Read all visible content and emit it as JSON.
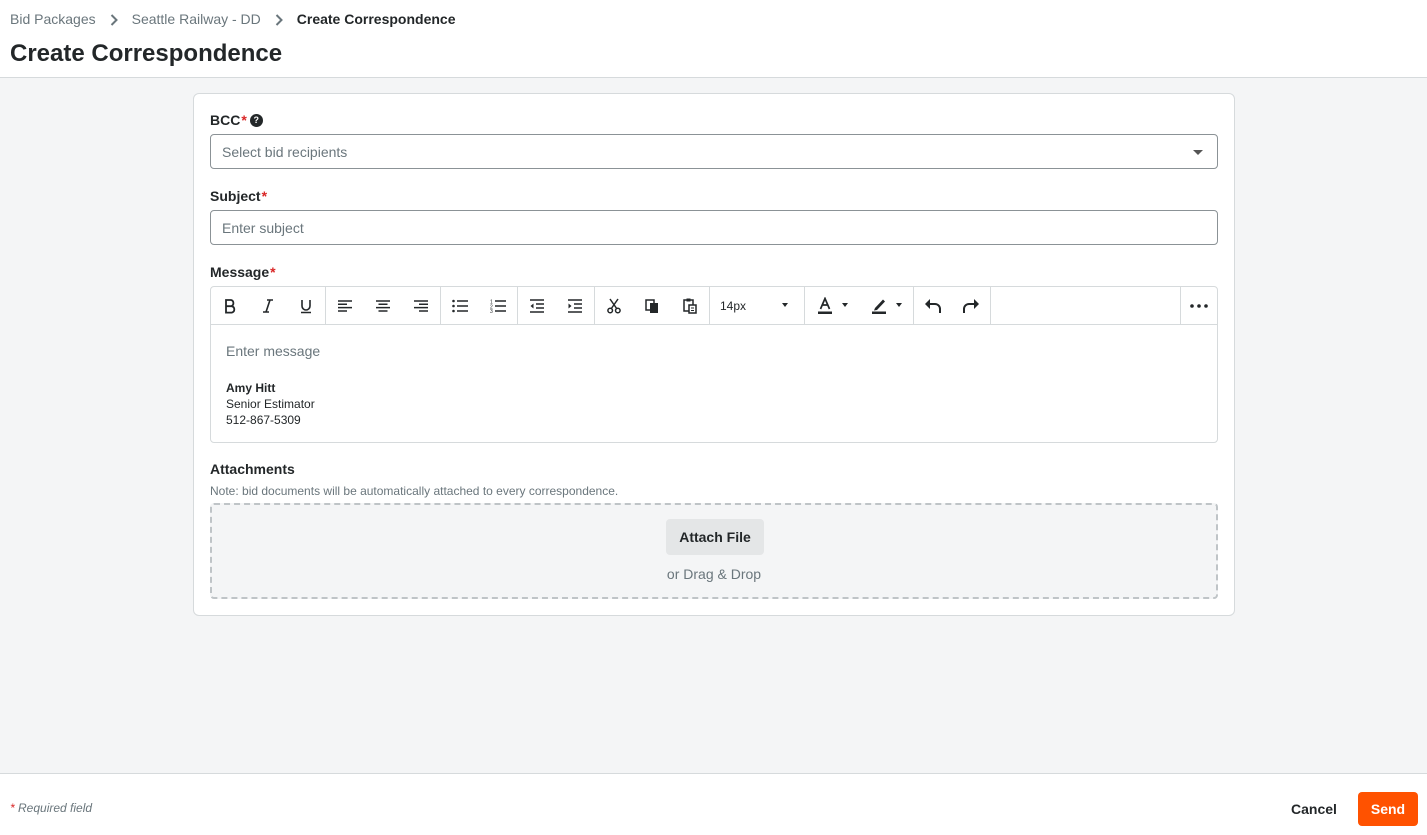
{
  "breadcrumb": {
    "items": [
      "Bid Packages",
      "Seattle Railway - DD",
      "Create Correspondence"
    ]
  },
  "page": {
    "title": "Create Correspondence"
  },
  "form": {
    "bcc": {
      "label": "BCC",
      "required_marker": "*",
      "help_icon": "question-circle-icon",
      "placeholder": "Select bid recipients"
    },
    "subject": {
      "label": "Subject",
      "required_marker": "*",
      "placeholder": "Enter subject",
      "value": ""
    },
    "message": {
      "label": "Message",
      "required_marker": "*",
      "placeholder": "Enter message",
      "font_size": "14px",
      "toolbar_icons": [
        "bold-icon",
        "italic-icon",
        "underline-icon",
        "align-left-icon",
        "align-center-icon",
        "align-right-icon",
        "bulleted-list-icon",
        "numbered-list-icon",
        "outdent-icon",
        "indent-icon",
        "cut-icon",
        "copy-icon",
        "paste-icon",
        "font-size-select",
        "font-color-icon",
        "highlight-color-icon",
        "undo-icon",
        "redo-icon",
        "more-icon"
      ],
      "signature": {
        "name": "Amy Hitt",
        "title": "Senior Estimator",
        "phone": "512-867-5309"
      }
    },
    "attachments": {
      "label": "Attachments",
      "note": "Note: bid documents will be automatically attached to every correspondence.",
      "attach_button": "Attach File",
      "drag_text": "or Drag & Drop"
    }
  },
  "footer": {
    "required_star": "*",
    "required_note": "Required field",
    "cancel_label": "Cancel",
    "send_label": "Send"
  },
  "colors": {
    "accent": "#ff5200",
    "required": "#d92626",
    "border": "#d6dadc",
    "background": "#f4f5f6"
  }
}
